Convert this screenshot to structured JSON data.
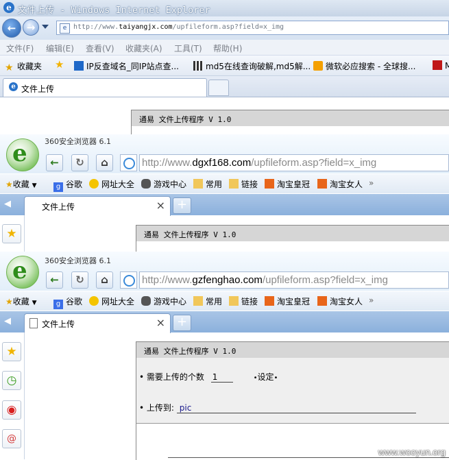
{
  "ie": {
    "window_title": "文件上传 - Windows Internet Explorer",
    "url_dim": "http://www.",
    "url_domain": "taiyangjx.com",
    "url_rest": "/upfileform.asp?field=x_img",
    "menu": [
      "文件(F)",
      "编辑(E)",
      "查看(V)",
      "收藏夹(A)",
      "工具(T)",
      "帮助(H)"
    ],
    "favorites_label": "收藏夹",
    "fav_links": [
      "IP反查域名_同IP站点查...",
      "md5在线查询破解,md5解...",
      "微软必应搜索 - 全球搜...",
      "M"
    ],
    "tab_title": "文件上传",
    "tool_title": "通易 文件上传程序 V 1.0"
  },
  "b360_1": {
    "version": "360安全浏览器 6.1",
    "url_dim": "http://www.",
    "url_domain": "dgxf168.com",
    "url_rest": "/upfileform.asp?field=x_img",
    "tab_title": "文件上传",
    "tool_title": "通易 文件上传程序 V 1.0"
  },
  "b360_2": {
    "version": "360安全浏览器 6.1",
    "url_dim": "http://www.",
    "url_domain": "gzfenghao.com",
    "url_rest": "/upfileform.asp?field=x_img",
    "tab_title": "文件上传",
    "tool_title": "通易 文件上传程序 V 1.0",
    "form": {
      "count_label": "需要上传的个数",
      "count_value": "1",
      "set_label": "设定",
      "upload_to_label": "上传到:",
      "upload_to_value": "pic"
    }
  },
  "bookmarks360": {
    "favorites": "收藏",
    "items": [
      "谷歌",
      "网址大全",
      "游戏中心",
      "常用",
      "链接",
      "淘宝皇冠",
      "淘宝女人"
    ],
    "more": "»"
  },
  "watermark": "www.wooyun.org"
}
